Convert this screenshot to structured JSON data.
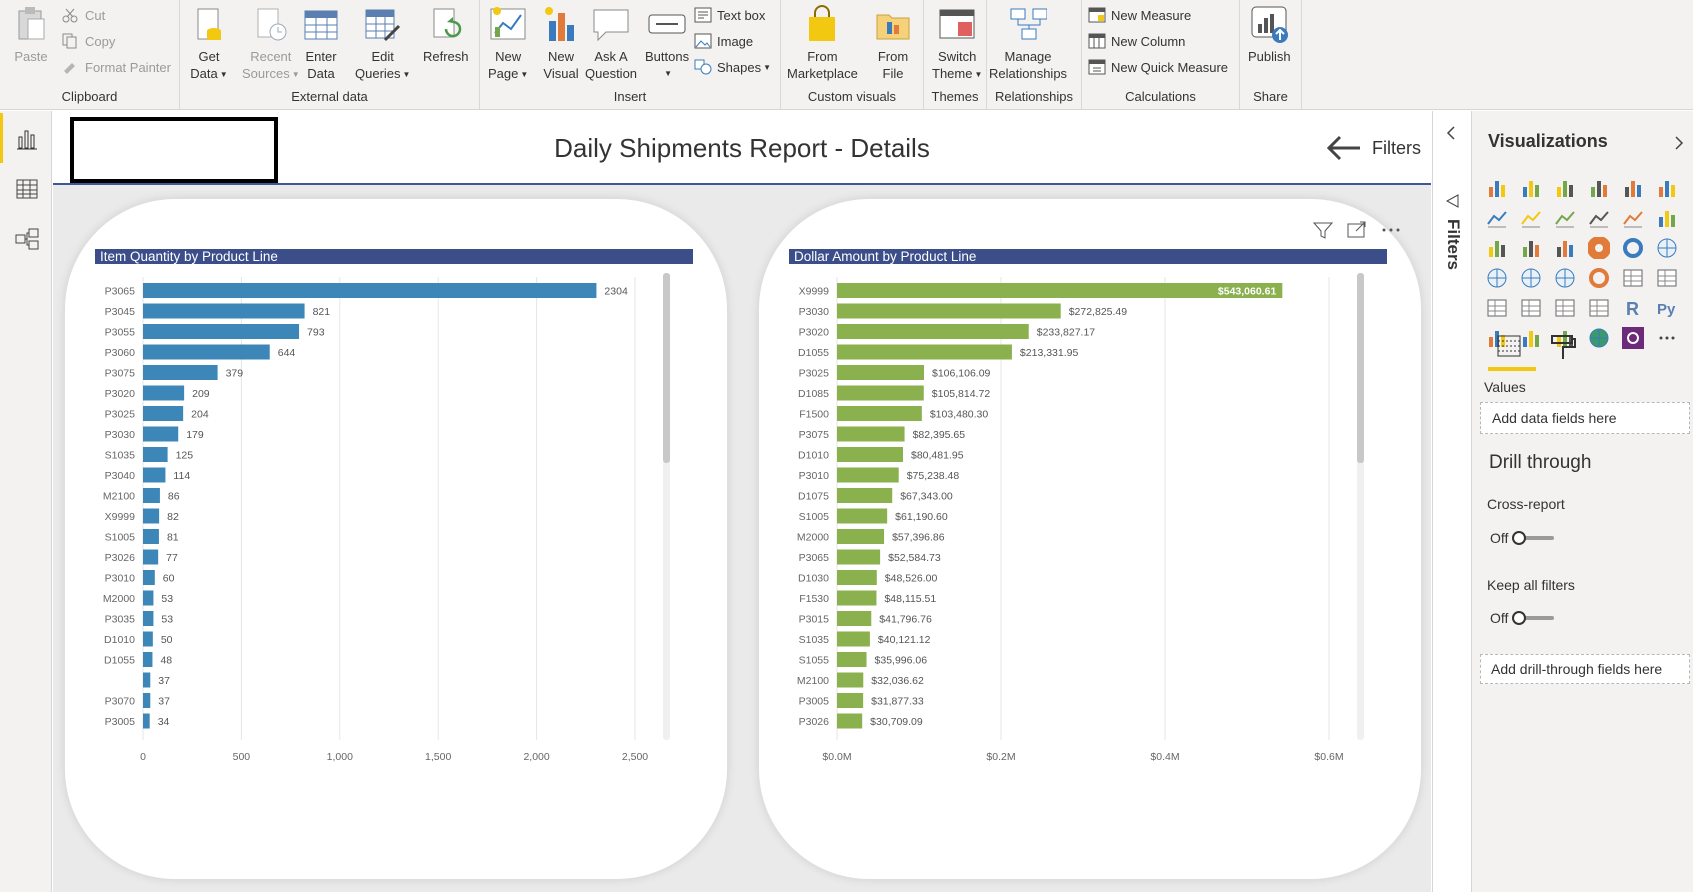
{
  "ribbon": {
    "clipboard": {
      "label": "Clipboard",
      "paste": "Paste",
      "cut": "Cut",
      "copy": "Copy",
      "format_painter": "Format Painter"
    },
    "external": {
      "label": "External data",
      "get_data": [
        "Get",
        "Data"
      ],
      "recent_sources": [
        "Recent",
        "Sources"
      ],
      "enter_data": [
        "Enter",
        "Data"
      ],
      "edit_queries": [
        "Edit",
        "Queries"
      ],
      "refresh": "Refresh"
    },
    "insert": {
      "label": "Insert",
      "new_page": [
        "New",
        "Page"
      ],
      "new_visual": [
        "New",
        "Visual"
      ],
      "ask_question": [
        "Ask A",
        "Question"
      ],
      "buttons": "Buttons",
      "text_box": "Text box",
      "image": "Image",
      "shapes": "Shapes"
    },
    "custom_visuals": {
      "label": "Custom visuals",
      "from_marketplace": [
        "From",
        "Marketplace"
      ],
      "from_file": [
        "From",
        "File"
      ]
    },
    "themes": {
      "label": "Themes",
      "switch_theme": [
        "Switch",
        "Theme"
      ]
    },
    "relationships": {
      "label": "Relationships",
      "manage": [
        "Manage",
        "Relationships"
      ]
    },
    "calculations": {
      "label": "Calculations",
      "new_measure": "New Measure",
      "new_column": "New Column",
      "new_quick_measure": "New Quick Measure"
    },
    "share": {
      "label": "Share",
      "publish": "Publish"
    }
  },
  "report": {
    "title": "Daily Shipments Report - Details",
    "filters_link": "Filters"
  },
  "filters_pane": {
    "label": "Filters"
  },
  "viz_pane": {
    "title": "Visualizations",
    "values_label": "Values",
    "values_placeholder": "Add data fields here",
    "drill_through": "Drill through",
    "cross_report": "Cross-report",
    "cross_report_state": "Off",
    "keep_all_filters": "Keep all filters",
    "keep_all_filters_state": "Off",
    "drill_placeholder": "Add drill-through fields here"
  },
  "chart_data": [
    {
      "type": "bar",
      "orientation": "horizontal",
      "title": "Item Quantity by Product Line",
      "color": "#3c87b7",
      "categories": [
        "P3065",
        "P3045",
        "P3055",
        "P3060",
        "P3075",
        "P3020",
        "P3025",
        "P3030",
        "S1035",
        "P3040",
        "M2100",
        "X9999",
        "S1005",
        "P3026",
        "P3010",
        "M2000",
        "P3035",
        "D1010",
        "D1055",
        "",
        "P3070",
        "P3005"
      ],
      "values": [
        2304,
        821,
        793,
        644,
        379,
        209,
        204,
        179,
        125,
        114,
        86,
        82,
        81,
        77,
        60,
        53,
        53,
        50,
        48,
        37,
        37,
        34
      ],
      "labels": [
        "2304",
        "821",
        "793",
        "644",
        "379",
        "209",
        "204",
        "179",
        "125",
        "114",
        "86",
        "82",
        "81",
        "77",
        "60",
        "53",
        "53",
        "50",
        "48",
        "37",
        "37",
        "34"
      ],
      "xlim": [
        0,
        2500
      ],
      "xticks": [
        0,
        500,
        1000,
        1500,
        2000,
        2500
      ],
      "xtick_labels": [
        "0",
        "500",
        "1,000",
        "1,500",
        "2,000",
        "2,500"
      ],
      "grid": true
    },
    {
      "type": "bar",
      "orientation": "horizontal",
      "title": "Dollar Amount by Product Line",
      "color": "#8ab14e",
      "categories": [
        "X9999",
        "P3030",
        "P3020",
        "D1055",
        "P3025",
        "D1085",
        "F1500",
        "P3075",
        "D1010",
        "P3010",
        "D1075",
        "S1005",
        "M2000",
        "P3065",
        "D1030",
        "F1530",
        "P3015",
        "S1035",
        "S1055",
        "M2100",
        "P3005",
        "P3026"
      ],
      "values": [
        543060.61,
        272825.49,
        233827.17,
        213331.95,
        106106.09,
        105814.72,
        103480.3,
        82395.65,
        80481.95,
        75238.48,
        67343.0,
        61190.6,
        57396.86,
        52584.73,
        48526.0,
        48115.51,
        41796.76,
        40121.12,
        35996.06,
        32036.62,
        31877.33,
        30709.09
      ],
      "labels": [
        "$543,060.61",
        "$272,825.49",
        "$233,827.17",
        "$213,331.95",
        "$106,106.09",
        "$105,814.72",
        "$103,480.30",
        "$82,395.65",
        "$80,481.95",
        "$75,238.48",
        "$67,343.00",
        "$61,190.60",
        "$57,396.86",
        "$52,584.73",
        "$48,526.00",
        "$48,115.51",
        "$41,796.76",
        "$40,121.12",
        "$35,996.06",
        "$32,036.62",
        "$31,877.33",
        "$30,709.09"
      ],
      "xlim": [
        0,
        600000
      ],
      "xticks": [
        0,
        200000,
        400000,
        600000
      ],
      "xtick_labels": [
        "$0.0M",
        "$0.2M",
        "$0.4M",
        "$0.6M"
      ],
      "grid": true
    }
  ]
}
